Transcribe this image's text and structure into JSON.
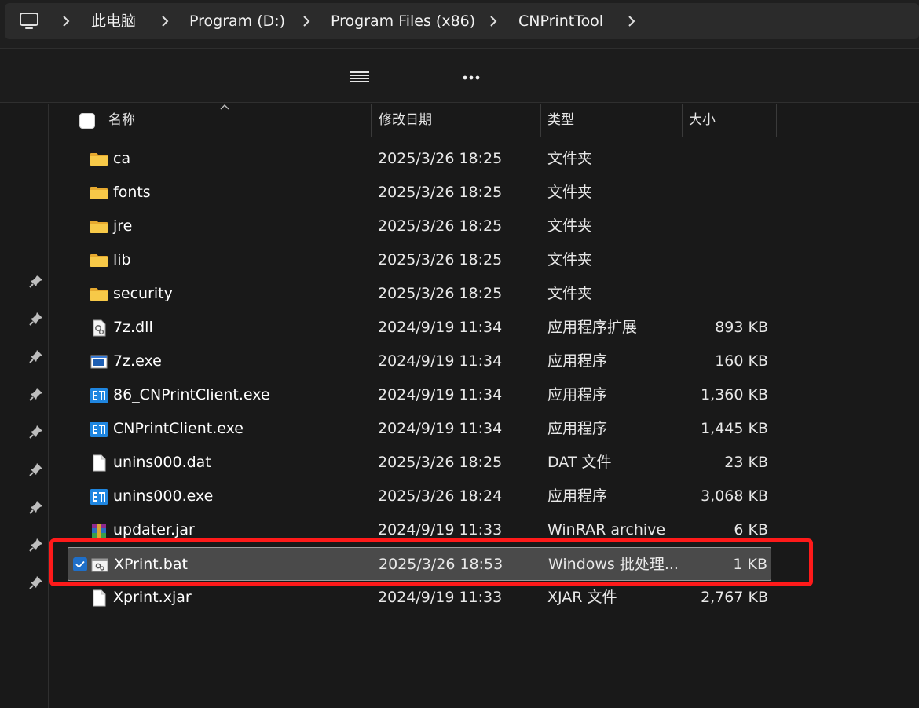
{
  "breadcrumb": {
    "items": [
      "此电脑",
      "Program (D:)",
      "Program Files (x86)",
      "CNPrintTool"
    ]
  },
  "toolbar": {
    "view_icon": "hamburger-menu-icon",
    "more_icon": "more-dots-icon"
  },
  "columns": {
    "name": "名称",
    "date": "修改日期",
    "type": "类型",
    "size": "大小"
  },
  "files": [
    {
      "name": "ca",
      "date": "2025/3/26 18:25",
      "type": "文件夹",
      "size": "",
      "icon": "folder-icon",
      "selected": false
    },
    {
      "name": "fonts",
      "date": "2025/3/26 18:25",
      "type": "文件夹",
      "size": "",
      "icon": "folder-icon",
      "selected": false
    },
    {
      "name": "jre",
      "date": "2025/3/26 18:25",
      "type": "文件夹",
      "size": "",
      "icon": "folder-icon",
      "selected": false
    },
    {
      "name": "lib",
      "date": "2025/3/26 18:25",
      "type": "文件夹",
      "size": "",
      "icon": "folder-icon",
      "selected": false
    },
    {
      "name": "security",
      "date": "2025/3/26 18:25",
      "type": "文件夹",
      "size": "",
      "icon": "folder-icon",
      "selected": false
    },
    {
      "name": "7z.dll",
      "date": "2024/9/19 11:34",
      "type": "应用程序扩展",
      "size": "893 KB",
      "icon": "dll-file-icon",
      "selected": false
    },
    {
      "name": "7z.exe",
      "date": "2024/9/19 11:34",
      "type": "应用程序",
      "size": "160 KB",
      "icon": "exe-file-icon",
      "selected": false
    },
    {
      "name": "86_CNPrintClient.exe",
      "date": "2024/9/19 11:34",
      "type": "应用程序",
      "size": "1,360 KB",
      "icon": "cnprint-app-icon",
      "selected": false
    },
    {
      "name": "CNPrintClient.exe",
      "date": "2024/9/19 11:34",
      "type": "应用程序",
      "size": "1,445 KB",
      "icon": "cnprint-app-icon",
      "selected": false
    },
    {
      "name": "unins000.dat",
      "date": "2025/3/26 18:25",
      "type": "DAT 文件",
      "size": "23 KB",
      "icon": "blank-file-icon",
      "selected": false
    },
    {
      "name": "unins000.exe",
      "date": "2025/3/26 18:24",
      "type": "应用程序",
      "size": "3,068 KB",
      "icon": "cnprint-app-icon",
      "selected": false
    },
    {
      "name": "updater.jar",
      "date": "2024/9/19 11:33",
      "type": "WinRAR archive",
      "size": "6 KB",
      "icon": "winrar-archive-icon",
      "selected": false
    },
    {
      "name": "XPrint.bat",
      "date": "2025/3/26 18:53",
      "type": "Windows 批处理...",
      "size": "1 KB",
      "icon": "batch-file-icon",
      "selected": true
    },
    {
      "name": "Xprint.xjar",
      "date": "2024/9/19 11:33",
      "type": "XJAR 文件",
      "size": "2,767 KB",
      "icon": "blank-file-icon",
      "selected": false
    }
  ],
  "colors": {
    "background": "#191919",
    "selected_row": "#4a4a4a",
    "highlight_annotation": "#ff1a1a",
    "folder": "#f5c542",
    "checkbox_accent": "#1f6fc9"
  }
}
